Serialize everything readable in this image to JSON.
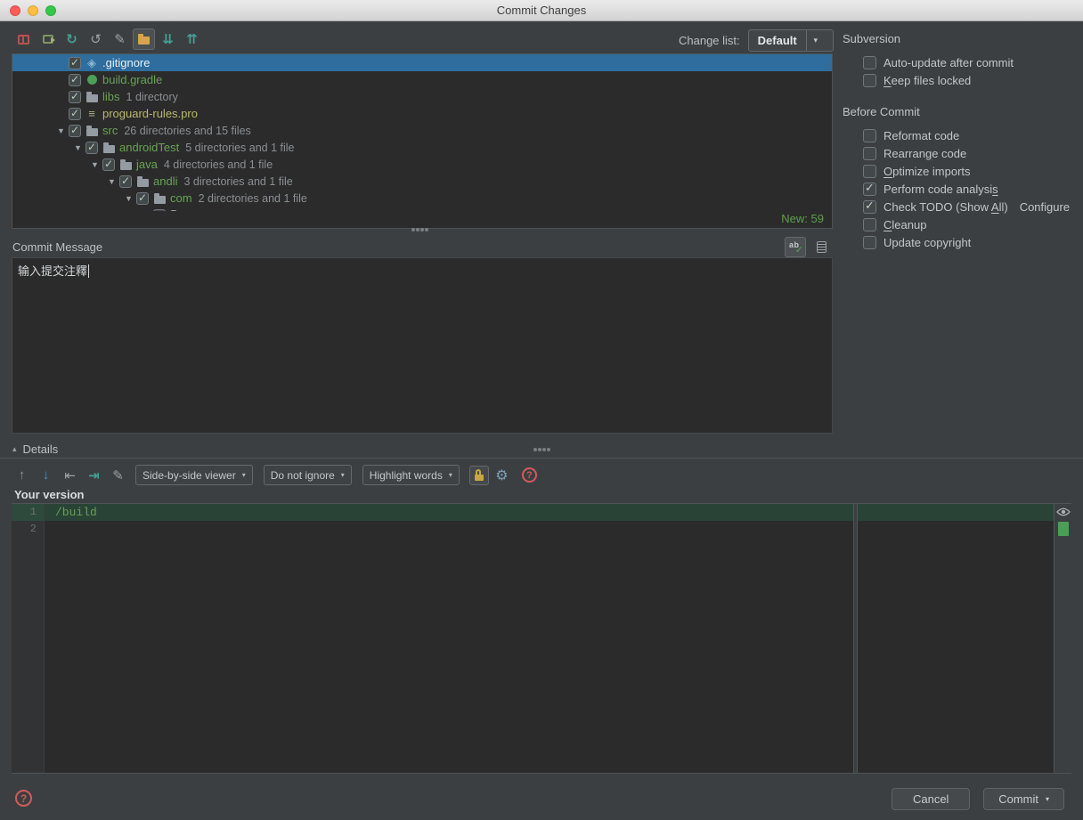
{
  "window": {
    "title": "Commit Changes"
  },
  "toolbar": {
    "change_list_label": "Change list:",
    "change_list_value": "Default",
    "icons": {
      "refresh": "↻",
      "rollback": "↺",
      "edit_source": "✎",
      "expand_all": "⇊",
      "collapse_all": "⇈"
    }
  },
  "ui": {
    "combo_arrow": "▾",
    "details_triangle": "▴",
    "tree_arrow": "▼",
    "help": "?",
    "commit_arrow": "▾"
  },
  "tree": {
    "icons": {
      "gitignore_glyph": "◈",
      "proguard_glyph": "≡"
    },
    "rows": [
      {
        "arrow": false,
        "checked": true,
        "icon": "gitignore-icon",
        "name": ".gitignore",
        "meta": "",
        "selected": true,
        "color": "#e9eef2"
      },
      {
        "arrow": false,
        "checked": true,
        "icon": "gradle-icon",
        "name": "build.gradle",
        "meta": "",
        "selected": false,
        "color": "#68a357"
      },
      {
        "arrow": false,
        "checked": true,
        "icon": "folder-icon",
        "name": "libs",
        "meta": "1 directory",
        "selected": false,
        "color": "#68a357"
      },
      {
        "arrow": false,
        "checked": true,
        "icon": "text-file-icon",
        "name": "proguard-rules.pro",
        "meta": "",
        "selected": false,
        "color": "#bdb76b"
      },
      {
        "arrow": true,
        "checked": true,
        "icon": "folder-icon",
        "name": "src",
        "meta": "26 directories and 15 files",
        "selected": false,
        "color": "#68a357"
      },
      {
        "arrow": true,
        "checked": true,
        "icon": "folder-icon",
        "name": "androidTest",
        "meta": "5 directories and 1 file",
        "selected": false,
        "color": "#68a357"
      },
      {
        "arrow": true,
        "checked": true,
        "icon": "folder-icon",
        "name": "java",
        "meta": "4 directories and 1 file",
        "selected": false,
        "color": "#68a357"
      },
      {
        "arrow": true,
        "checked": true,
        "icon": "folder-icon",
        "name": "andli",
        "meta": "3 directories and 1 file",
        "selected": false,
        "color": "#68a357"
      },
      {
        "arrow": true,
        "checked": true,
        "icon": "folder-icon",
        "name": "com",
        "meta": "2 directories and 1 file",
        "selected": false,
        "color": "#68a357"
      },
      {
        "arrow": true,
        "checked": true,
        "icon": "folder-icon",
        "name": "",
        "meta": "",
        "selected": false,
        "color": "#68a357"
      }
    ],
    "status": "New: 59",
    "status_color": "#5da04b"
  },
  "commit_message": {
    "label": "Commit Message",
    "text": "输入提交注釋",
    "icons": {
      "spell_text": "ab",
      "spell_check": "✓"
    }
  },
  "details": {
    "label": "Details"
  },
  "diff_toolbar": {
    "icons": {
      "previous": "↑",
      "next": "↓",
      "jump_first": "⇤",
      "jump_last": "⇥",
      "edit": "✎",
      "gear": "⚙"
    },
    "viewer_select": "Side-by-side viewer",
    "ignore_select": "Do not ignore",
    "highlight_select": "Highlight words"
  },
  "diff": {
    "column_label": "Your version",
    "lines": [
      {
        "num": "1",
        "text": "/build",
        "added": true
      },
      {
        "num": "2",
        "text": "",
        "added": false
      }
    ]
  },
  "right_panel": {
    "subversion_title": "Subversion",
    "subversion_items": [
      {
        "label": "Auto-update after commit",
        "checked": false
      },
      {
        "label": "Keep files locked",
        "checked": false,
        "u": 0
      }
    ],
    "before_commit_title": "Before Commit",
    "before_commit_items": [
      {
        "label": "Reformat code",
        "checked": false
      },
      {
        "label": "Rearrange code",
        "checked": false,
        "u": 7
      },
      {
        "label": "Optimize imports",
        "checked": false,
        "u": 0
      },
      {
        "label": "Perform code analysis",
        "checked": true,
        "u": 20
      },
      {
        "label": "Check TODO (Show All)",
        "checked": true,
        "u": 17
      },
      {
        "label": "Cleanup",
        "checked": false,
        "u": 0
      },
      {
        "label": "Update copyright",
        "checked": false
      }
    ],
    "configure_link": "Configure"
  },
  "footer": {
    "cancel": "Cancel",
    "commit": "Commit"
  },
  "colors": {
    "selection_blue": "#2e6d9e",
    "added_line_bg": "#294436",
    "new_file_green": "#68a357",
    "unversioned_khaki": "#bdb76b",
    "accent_red": "#c75450"
  }
}
